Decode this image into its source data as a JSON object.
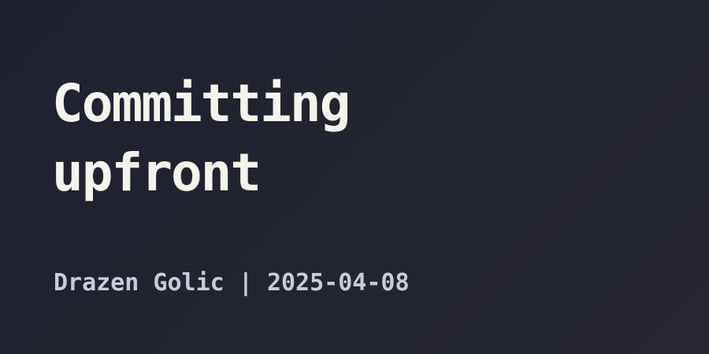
{
  "post": {
    "title_lines": [
      "Committing",
      "upfront"
    ],
    "author": "Drazen Golic",
    "separator": "|",
    "date": "2025-04-08"
  },
  "colors": {
    "background": "#22242e",
    "title": "#f4f3ec",
    "meta": "#c9ccd8"
  }
}
